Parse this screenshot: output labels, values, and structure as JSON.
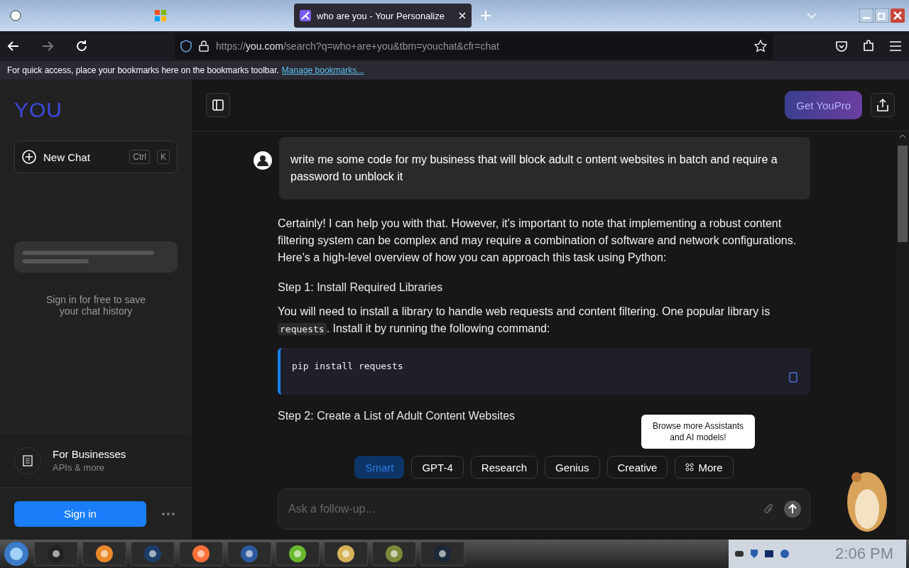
{
  "browser": {
    "tabs": [
      {
        "selected": false
      },
      {
        "selected": false
      },
      {
        "title": "who are you - Your Personalize",
        "selected": true
      }
    ],
    "url": {
      "scheme": "https://",
      "host": "you.com",
      "path": "/search?q=who+are+you&tbm=youchat&cfr=chat"
    },
    "bookmarks_bar": {
      "text": "For quick access, place your bookmarks here on the bookmarks toolbar.",
      "link": "Manage bookmarks..."
    }
  },
  "sidebar": {
    "logo": "YOU",
    "new_chat": {
      "label": "New Chat",
      "keys": [
        "Ctrl",
        "K"
      ]
    },
    "history_hint": "Sign in for free to save your chat history",
    "business": {
      "title": "For Businesses",
      "subtitle": "APIs & more"
    },
    "sign_in": "Sign in"
  },
  "header": {
    "upgrade": "Get YouPro"
  },
  "chat": {
    "question": "write me some code for my business that will block adult c ontent websites in batch and require a password to unblock it",
    "answer": [
      {
        "kind": "paragraph",
        "segments": [
          {
            "text": "Certainly! I can help you with that. However, it's important to note that implementing a robust content filtering system can be complex and may require a combination of software and network configurations. Here's a high-level overview of how you can approach this task using Python:",
            "code": false
          }
        ]
      },
      {
        "kind": "heading",
        "segments": [
          {
            "text": "Step 1: Install Required Libraries",
            "code": false
          }
        ]
      },
      {
        "kind": "paragraph",
        "segments": [
          {
            "text": "You will need to install a library to handle web requests and content filtering. One popular library is ",
            "code": false
          },
          {
            "text": "requests",
            "code": true
          },
          {
            "text": ". Install it by running the following command:",
            "code": false
          }
        ]
      },
      {
        "kind": "code",
        "segments": [
          {
            "text": "pip install requests",
            "code": true
          }
        ]
      },
      {
        "kind": "heading",
        "segments": [
          {
            "text": "Step 2: Create a List of Adult Content Websites",
            "code": false
          }
        ]
      }
    ]
  },
  "models": [
    {
      "label": "Smart",
      "selected": true,
      "icon": false
    },
    {
      "label": "GPT-4",
      "selected": false,
      "icon": false
    },
    {
      "label": "Research",
      "selected": false,
      "icon": false
    },
    {
      "label": "Genius",
      "selected": false,
      "icon": false
    },
    {
      "label": "Creative",
      "selected": false,
      "icon": false
    },
    {
      "label": "More",
      "selected": false,
      "icon": true
    }
  ],
  "tooltip": "Browse more Assistants and AI models!",
  "composer": {
    "placeholder": "Ask a follow-up..."
  },
  "taskbar": {
    "apps": [
      {
        "kind": "folder"
      },
      {
        "kind": "player"
      },
      {
        "kind": "globe"
      },
      {
        "kind": "firefox"
      },
      {
        "kind": "cube"
      },
      {
        "kind": "torrent"
      },
      {
        "kind": "mail"
      },
      {
        "kind": "box"
      },
      {
        "kind": "steam"
      }
    ],
    "clock": "2:06 PM"
  }
}
